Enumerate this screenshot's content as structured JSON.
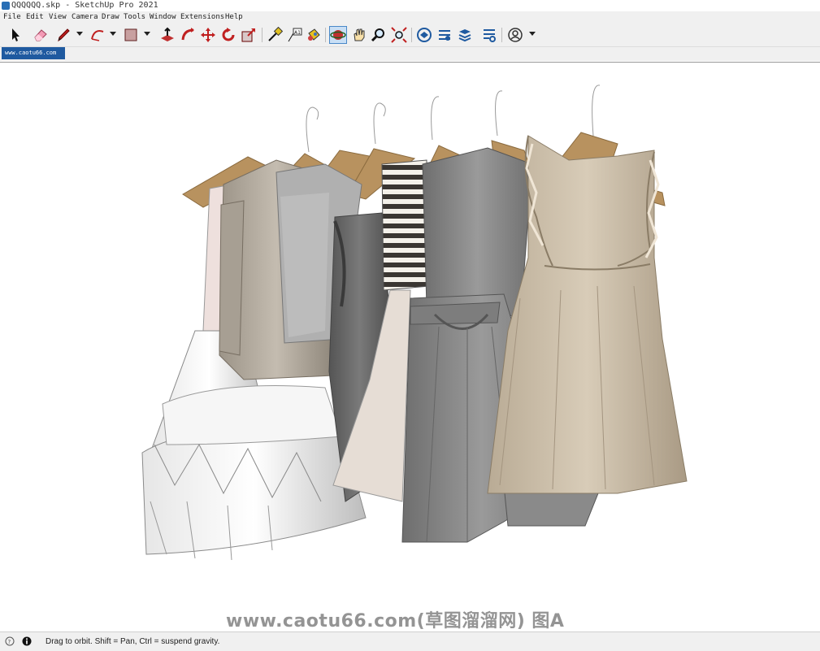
{
  "window": {
    "title": "QQQQQQ.skp - SketchUp Pro 2021"
  },
  "menu": [
    "File",
    "Edit",
    "View",
    "Camera",
    "Draw",
    "Tools",
    "Window",
    "Extensions",
    "Help"
  ],
  "toolbar": {
    "icons": [
      "select-icon",
      "eraser-icon",
      "pencil-icon",
      "arc-icon",
      "rectangle-icon",
      "push-pull-icon",
      "follow-me-icon",
      "move-icon",
      "rotate-icon",
      "scale-icon",
      "tape-measure-icon",
      "text-icon",
      "paint-bucket-icon",
      "orbit-icon",
      "pan-icon",
      "zoom-icon",
      "zoom-extents-icon",
      "3d-warehouse-icon",
      "extension-warehouse-icon",
      "layout-icon",
      "extension-manager-icon",
      "profile-icon"
    ],
    "active": "orbit-icon"
  },
  "scene_tab": {
    "label": "www.caotu66.com"
  },
  "viewport": {
    "watermark": "www.caotu66.com(草图溜溜网) 图A",
    "model": "clothes-rack-dresses"
  },
  "status": {
    "text": "Drag to orbit.  Shift = Pan, Ctrl = suspend gravity."
  },
  "colors": {
    "accent": "#1f5aa0",
    "hanger": "#b8925f",
    "chrome": "#f0f0f0"
  }
}
